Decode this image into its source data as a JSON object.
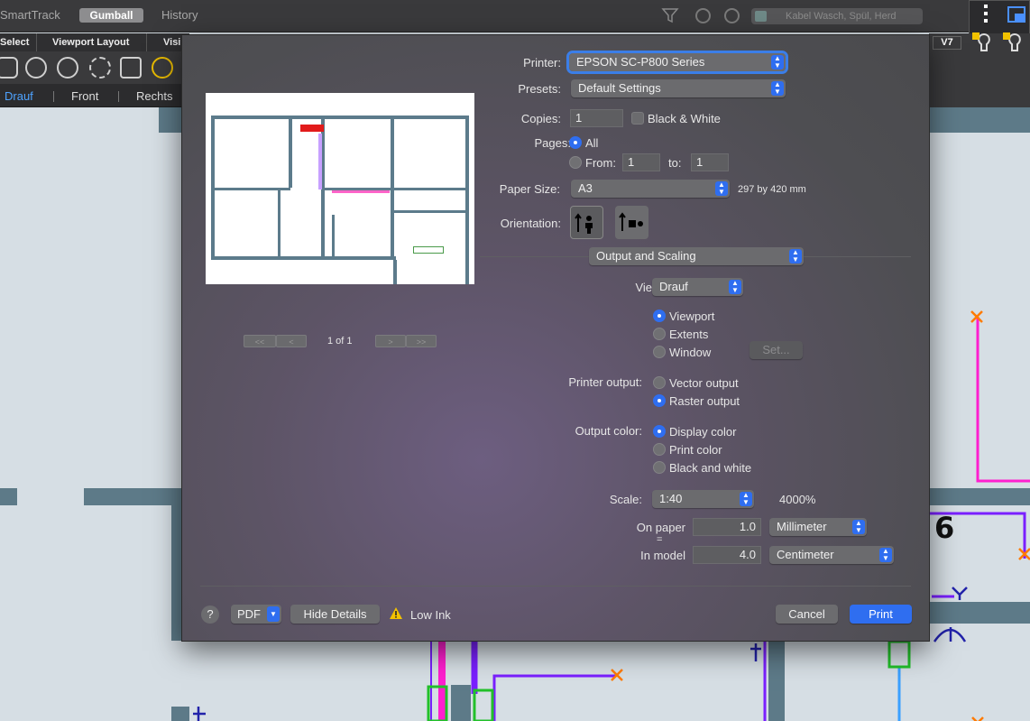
{
  "app": {
    "menu_items": [
      "SmartTrack",
      "Gumball",
      "History"
    ],
    "search_placeholder": "Kabel Wasch, Spül, Herd",
    "tabs": [
      "Select",
      "Viewport Layout",
      "Visi"
    ],
    "view_tabs": [
      "Drauf",
      "Front",
      "Rechts"
    ],
    "v7_label": "V7",
    "canvas_number": "6"
  },
  "print_dialog": {
    "printer_label": "Printer:",
    "printer_value": "EPSON SC-P800 Series",
    "presets_label": "Presets:",
    "presets_value": "Default Settings",
    "copies_label": "Copies:",
    "copies_value": "1",
    "bw_label": "Black & White",
    "pages_label": "Pages:",
    "pages_all": "All",
    "pages_from_label": "From:",
    "pages_from_value": "1",
    "pages_to_label": "to:",
    "pages_to_value": "1",
    "paper_size_label": "Paper Size:",
    "paper_size_value": "A3",
    "paper_dimensions": "297 by 420 mm",
    "orientation_label": "Orientation:",
    "section_value": "Output and Scaling",
    "view_label": "View:",
    "view_value": "Drauf",
    "view_options": [
      "Viewport",
      "Extents",
      "Window"
    ],
    "view_selected": "Viewport",
    "set_button": "Set...",
    "printer_output_label": "Printer output:",
    "printer_output_options": [
      "Vector output",
      "Raster output"
    ],
    "printer_output_selected": "Raster output",
    "output_color_label": "Output color:",
    "output_color_options": [
      "Display color",
      "Print color",
      "Black and white"
    ],
    "output_color_selected": "Display color",
    "scale_label": "Scale:",
    "scale_value": "1:40",
    "scale_percent": "4000%",
    "on_paper_label": "On paper",
    "equals_label": "=",
    "on_paper_value": "1.0",
    "on_paper_unit": "Millimeter",
    "in_model_label": "In model",
    "in_model_value": "4.0",
    "in_model_unit": "Centimeter",
    "page_indicator": "1 of 1",
    "nav_first": "<<",
    "nav_prev": "<",
    "nav_next": ">",
    "nav_last": ">>",
    "help_label": "?",
    "pdf_label": "PDF",
    "hide_details_label": "Hide Details",
    "low_ink_label": "Low Ink",
    "cancel_label": "Cancel",
    "print_label": "Print"
  },
  "colors": {
    "accent": "#2f6ef0",
    "magenta_line": "#ff1fcf",
    "violet_line": "#7a1fff",
    "orange_marker": "#ff7a00",
    "green_symbol": "#22c02a",
    "wall": "#5c7b8b"
  }
}
